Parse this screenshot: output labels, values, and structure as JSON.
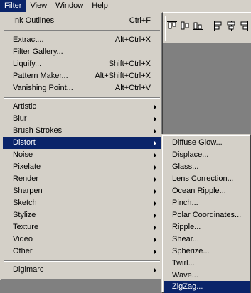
{
  "menubar": {
    "items": [
      {
        "label": "Filter",
        "active": true
      },
      {
        "label": "View",
        "active": false
      },
      {
        "label": "Window",
        "active": false
      },
      {
        "label": "Help",
        "active": false
      }
    ]
  },
  "toolbar": {
    "icons": [
      "align-top-edges-icon",
      "align-vertical-centers-icon",
      "align-bottom-edges-icon",
      "align-left-edges-icon",
      "align-horizontal-centers-icon",
      "align-right-edges-icon"
    ]
  },
  "filter_menu": {
    "top": [
      {
        "label": "Ink Outlines",
        "shortcut": "Ctrl+F"
      }
    ],
    "group2": [
      {
        "label": "Extract...",
        "shortcut": "Alt+Ctrl+X"
      },
      {
        "label": "Filter Gallery...",
        "shortcut": ""
      },
      {
        "label": "Liquify...",
        "shortcut": "Shift+Ctrl+X"
      },
      {
        "label": "Pattern Maker...",
        "shortcut": "Alt+Shift+Ctrl+X"
      },
      {
        "label": "Vanishing Point...",
        "shortcut": "Alt+Ctrl+V"
      }
    ],
    "submenus": [
      {
        "label": "Artistic"
      },
      {
        "label": "Blur"
      },
      {
        "label": "Brush Strokes"
      },
      {
        "label": "Distort",
        "highlighted": true
      },
      {
        "label": "Noise"
      },
      {
        "label": "Pixelate"
      },
      {
        "label": "Render"
      },
      {
        "label": "Sharpen"
      },
      {
        "label": "Sketch"
      },
      {
        "label": "Stylize"
      },
      {
        "label": "Texture"
      },
      {
        "label": "Video"
      },
      {
        "label": "Other"
      }
    ],
    "bottom": [
      {
        "label": "Digimarc"
      }
    ]
  },
  "distort_submenu": {
    "items": [
      {
        "label": "Diffuse Glow..."
      },
      {
        "label": "Displace..."
      },
      {
        "label": "Glass..."
      },
      {
        "label": "Lens Correction..."
      },
      {
        "label": "Ocean Ripple..."
      },
      {
        "label": "Pinch..."
      },
      {
        "label": "Polar Coordinates..."
      },
      {
        "label": "Ripple..."
      },
      {
        "label": "Shear..."
      },
      {
        "label": "Spherize..."
      },
      {
        "label": "Twirl..."
      },
      {
        "label": "Wave..."
      },
      {
        "label": "ZigZag...",
        "highlighted": true
      }
    ]
  },
  "colors": {
    "menu_bg": "#d4d0c8",
    "highlight": "#0a246a",
    "workspace": "#808080"
  }
}
